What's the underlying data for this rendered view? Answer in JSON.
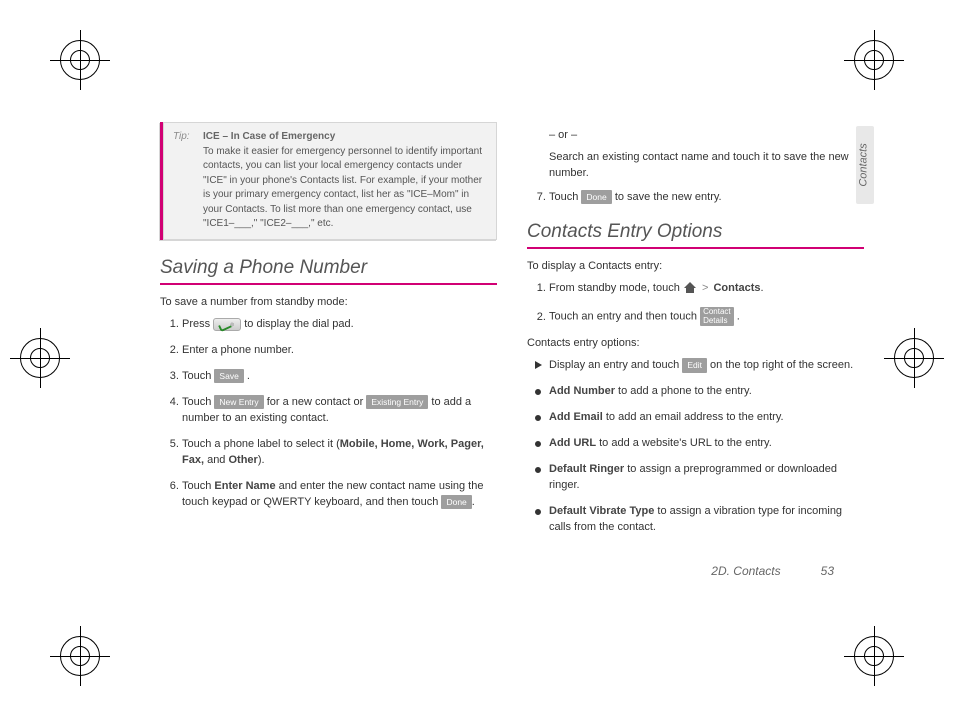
{
  "sideTab": "Contacts",
  "footer": {
    "section": "2D. Contacts",
    "page": "53"
  },
  "tip": {
    "label": "Tip:",
    "title": "ICE – In Case of Emergency",
    "body": "To make it easier for emergency personnel to identify important contacts, you can list your local emergency contacts under \"ICE\" in your phone's Contacts list. For example, if your mother is your primary emergency contact, list her as \"ICE–Mom\" in your Contacts. To list more than one emergency contact, use \"ICE1–___,\" \"ICE2–___,\" etc."
  },
  "left": {
    "heading": "Saving a Phone Number",
    "lead": "To save a number from standby mode:",
    "steps": {
      "s1a": "Press ",
      "s1b": " to display the dial pad.",
      "s2": "Enter a phone number.",
      "s3a": "Touch ",
      "s3b": ".",
      "s4a": "Touch ",
      "s4b": " for a new contact or ",
      "s4c": " to add a number to an existing contact.",
      "s5a": "Touch a phone label to select it (",
      "s5b": "Mobile, Home, Work, Pager, Fax,",
      "s5c": " and ",
      "s5d": "Other",
      "s5e": ").",
      "s6a": "Touch ",
      "s6b": "Enter Name",
      "s6c": " and enter the new contact name using the touch keypad or QWERTY keyboard, and then touch ",
      "s6d": "."
    },
    "btns": {
      "save": "Save",
      "newEntry": "New Entry",
      "existingEntry": "Existing Entry",
      "done": "Done"
    }
  },
  "right": {
    "or": "– or –",
    "orText": "Search an existing contact name and touch it to save the new number.",
    "s7a": "Touch ",
    "s7b": " to save the new entry.",
    "btnDone": "Done",
    "heading": "Contacts Entry Options",
    "lead1": "To display a Contacts entry:",
    "d1a": "From standby mode, touch ",
    "d1b": "Contacts",
    "d1c": ".",
    "gt": ">",
    "d2a": "Touch an entry and then touch ",
    "d2b": ".",
    "btnContactDetails1": "Contact",
    "btnContactDetails2": "Details",
    "lead2": "Contacts entry options:",
    "o1a": "Display an entry and touch ",
    "o1b": " on the top right of the screen.",
    "btnEdit": "Edit",
    "o2a": "Add Number",
    "o2b": " to add a phone to the entry.",
    "o3a": "Add Email",
    "o3b": " to add an email address to the entry.",
    "o4a": "Add URL",
    "o4b": " to add a website's URL to the entry.",
    "o5a": "Default Ringer",
    "o5b": " to assign a preprogrammed or downloaded ringer.",
    "o6a": "Default Vibrate Type",
    "o6b": " to assign a vibration type for incoming calls from the contact."
  }
}
